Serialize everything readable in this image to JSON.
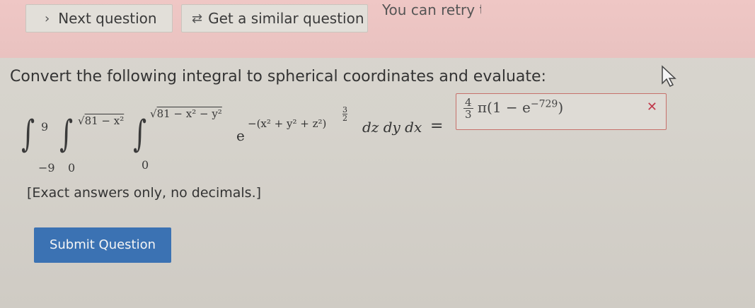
{
  "toolbar": {
    "next_label": "Next question",
    "similar_label": "Get a similar question",
    "retry_note": "You can retry this question"
  },
  "question": {
    "prompt": "Convert the following integral to spherical coordinates and evaluate:",
    "integral": {
      "outer_lower": "−9",
      "outer_upper": "9",
      "middle_lower": "0",
      "middle_upper_radical": "81 − x²",
      "inner_lower": "0",
      "inner_upper_radical": "81 − x² − y²",
      "integrand_base": "e",
      "integrand_exponent": "−(x² + y² + z²)",
      "exponent_power_num": "3",
      "exponent_power_den": "2",
      "differentials": "dz dy dx",
      "equals": "="
    },
    "answer": {
      "frac_num": "4",
      "frac_den": "3",
      "rest": "π(1 − e",
      "exponent": "−729",
      "close_paren": ")"
    },
    "note": "[Exact answers only, no decimals.]"
  },
  "actions": {
    "submit_label": "Submit Question"
  },
  "colors": {
    "topbar": "#eac4c2",
    "submit": "#3b72b3",
    "error_border": "#c7716b",
    "error_x": "#c0394b"
  },
  "icons": {
    "next": "chevron-right-icon",
    "similar": "repeat-icon",
    "answer_status": "close-icon",
    "cursor": "mouse-cursor-icon"
  }
}
